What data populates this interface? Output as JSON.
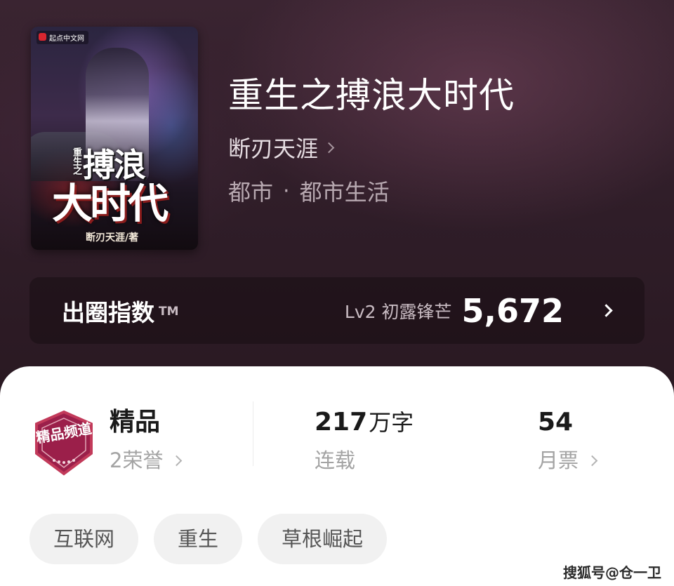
{
  "book": {
    "title": "重生之搏浪大时代",
    "author": "断刃天涯",
    "category": "都市",
    "separator": "·",
    "subcategory": "都市生活"
  },
  "cover": {
    "badge": "起点中文网",
    "title_small": "重生之",
    "title_line1": "搏浪",
    "title_line2": "大时代",
    "author_text": "断刃天涯/著"
  },
  "index": {
    "label": "出圈指数",
    "tm": "TM",
    "level": "Lv2 初露锋芒",
    "value": "5,672"
  },
  "stats": {
    "medal_text": "精品频道",
    "quality_label": "精品",
    "honors": "2荣誉",
    "word_count": "217",
    "word_unit": "万字",
    "status": "连载",
    "monthly_tickets": "54",
    "monthly_label": "月票"
  },
  "tags": [
    "互联网",
    "重生",
    "草根崛起"
  ],
  "watermark": "搜狐号@仓一卫",
  "colors": {
    "medal_fill": "#9b1f4a",
    "medal_border": "#c23a5a",
    "panel_bg": "#ffffff",
    "hero_bg": "#2f1d28"
  }
}
